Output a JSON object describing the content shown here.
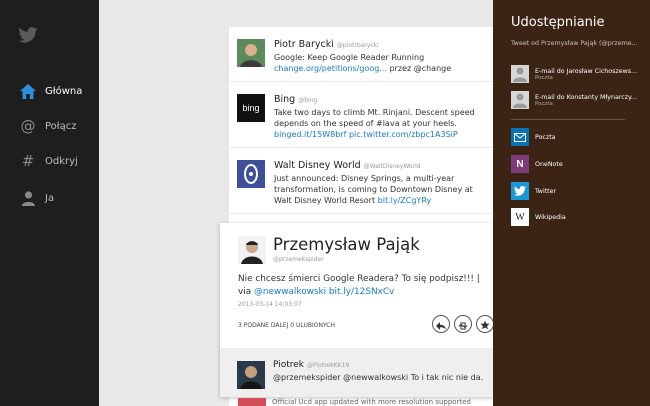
{
  "nav": {
    "items": [
      {
        "label": "Główna",
        "icon": "home-icon",
        "active": true
      },
      {
        "label": "Połącz",
        "icon": "at-icon",
        "active": false
      },
      {
        "label": "Odkryj",
        "icon": "hash-icon",
        "active": false
      },
      {
        "label": "Ja",
        "icon": "person-icon",
        "active": false
      }
    ]
  },
  "timeline": {
    "tweets": [
      {
        "name": "Piotr Barycki",
        "handle": "@piotrbarycki",
        "text": "Google: Keep Google Reader Running ",
        "link": "change.org/petitions/goog...",
        "tail": " przez @change"
      },
      {
        "name": "Bing",
        "handle": "@bing",
        "text": "Take two days to climb Mt. Rinjani. Descent speed depends on the speed of #lava at your heels. ",
        "link": "binged.it/15W8brf pic.twitter.com/zbpc1A3SiP",
        "tail": ""
      },
      {
        "name": "Walt Disney World",
        "handle": "@WaltDisneyWorld",
        "text": "Just announced: Disney Springs, a multi-year transformation, is coming to Downtown Disney at Walt Disney World Resort ",
        "link": "bit.ly/ZCgYRy",
        "tail": ""
      }
    ]
  },
  "expanded": {
    "name": "Przemysław Pająk",
    "handle": "@przemekspider",
    "text": "Nie chcesz śmierci Google Readera? To się podpisz!!! | via ",
    "link": "@newwalkowski bit.ly/12SNxCv",
    "timestamp": "2013-03-14 14:03:07",
    "stats": "3 PODANE DALEJ   0 ULUBIONYCH",
    "reply": {
      "name": "Piotrek",
      "handle": "@PiotrekKK19",
      "text": "@przemekspider @newwalkowski To i tak nic nie da."
    }
  },
  "below_text": "Official Ucd app updated with more resolution supported",
  "charm": {
    "title": "Udostępnianie",
    "subtitle": "Tweet od Przemysław Pająk (@przeme...",
    "contacts": [
      {
        "line1": "E-mail do Jarosław Cichoszews...",
        "line2": "Poczta"
      },
      {
        "line1": "E-mail do Konstanty Młynarczy...",
        "line2": "Poczta"
      }
    ],
    "apps": [
      {
        "label": "Poczta",
        "icon": "mail-icon",
        "color": "#0a72b0"
      },
      {
        "label": "OneNote",
        "icon": "onenote-icon",
        "color": "#80397b"
      },
      {
        "label": "Twitter",
        "icon": "twitter-icon",
        "color": "#1d96d8"
      },
      {
        "label": "Wikipedia",
        "icon": "wikipedia-icon",
        "color": "#ffffff"
      }
    ]
  }
}
